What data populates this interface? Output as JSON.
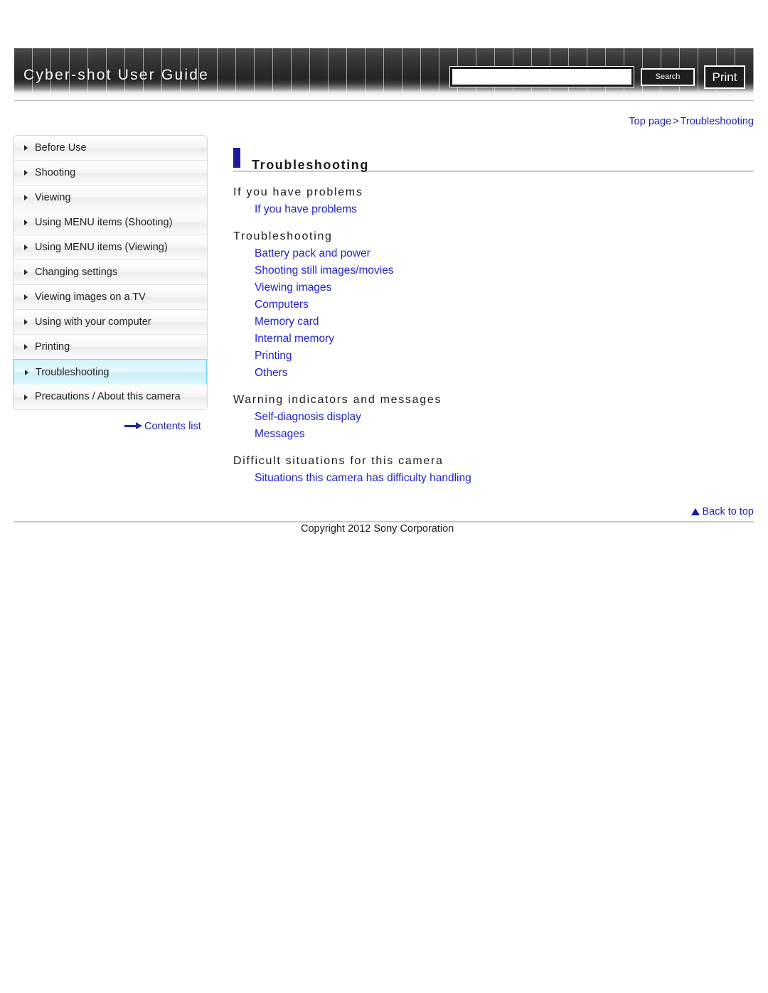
{
  "header": {
    "site_title": "Cyber-shot User Guide",
    "search": {
      "value": "",
      "placeholder": "",
      "button_label": "Search"
    },
    "print_label": "Print"
  },
  "breadcrumb": {
    "top_page": "Top page",
    "separator": ">",
    "current": "Troubleshooting"
  },
  "sidebar": {
    "items": [
      {
        "label": "Before Use",
        "active": false
      },
      {
        "label": "Shooting",
        "active": false
      },
      {
        "label": "Viewing",
        "active": false
      },
      {
        "label": "Using MENU items (Shooting)",
        "active": false
      },
      {
        "label": "Using MENU items (Viewing)",
        "active": false
      },
      {
        "label": "Changing settings",
        "active": false
      },
      {
        "label": "Viewing images on a TV",
        "active": false
      },
      {
        "label": "Using with your computer",
        "active": false
      },
      {
        "label": "Printing",
        "active": false
      },
      {
        "label": "Troubleshooting",
        "active": true
      },
      {
        "label": "Precautions / About this camera",
        "active": false
      }
    ],
    "contents_list_label": "Contents list"
  },
  "main": {
    "page_title": "Troubleshooting",
    "sections": [
      {
        "heading": "If you have problems",
        "links": [
          "If you have problems"
        ]
      },
      {
        "heading": "Troubleshooting",
        "links": [
          "Battery pack and power",
          "Shooting still images/movies",
          "Viewing images",
          "Computers",
          "Memory card",
          "Internal memory",
          "Printing",
          "Others"
        ]
      },
      {
        "heading": "Warning indicators and messages",
        "links": [
          "Self-diagnosis display",
          "Messages"
        ]
      },
      {
        "heading": "Difficult situations for this camera",
        "links": [
          "Situations this camera has difficulty handling"
        ]
      }
    ]
  },
  "footer": {
    "back_to_top_label": "Back to top",
    "copyright": "Copyright 2012 Sony Corporation"
  },
  "colors": {
    "link_blue": "#2222cc",
    "accent_navy": "#1b1b9b",
    "active_nav_border": "#6fd4ec",
    "header_dark": "#2b2b2b"
  }
}
